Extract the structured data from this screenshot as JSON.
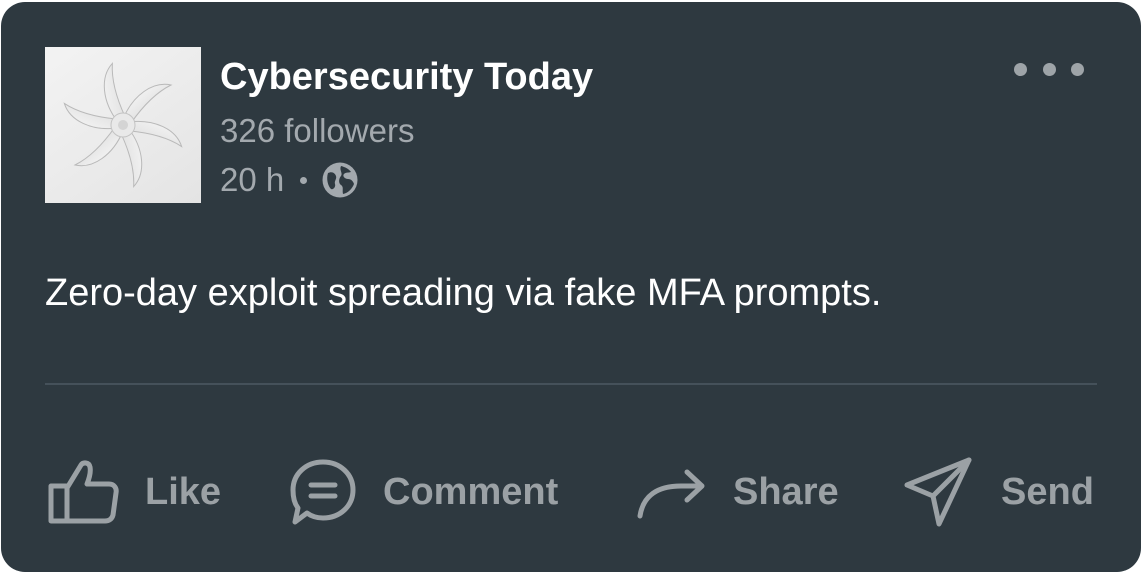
{
  "post": {
    "author": {
      "name": "Cybersecurity Today",
      "followers": "326 followers",
      "time": "20 h",
      "visibility_icon": "globe-icon"
    },
    "text": "Zero-day exploit spreading via fake MFA prompts."
  },
  "actions": {
    "like": "Like",
    "comment": "Comment",
    "share": "Share",
    "send": "Send"
  },
  "icons": {
    "more": "more-horizontal-icon",
    "like": "thumbs-up-icon",
    "comment": "comment-bubble-icon",
    "share": "share-arrow-icon",
    "send": "paper-plane-icon"
  },
  "colors": {
    "card_background": "#2e3940",
    "primary_text": "#ffffff",
    "secondary_text": "#a3a9ae",
    "action_color": "#9ba1a5"
  }
}
